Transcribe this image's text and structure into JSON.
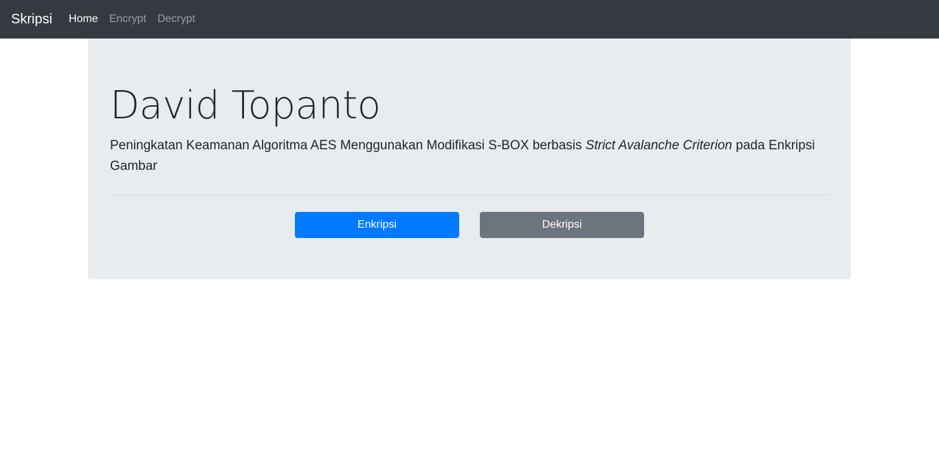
{
  "navbar": {
    "brand": "Skripsi",
    "links": [
      {
        "label": "Home",
        "active": true
      },
      {
        "label": "Encrypt",
        "active": false
      },
      {
        "label": "Decrypt",
        "active": false
      }
    ]
  },
  "jumbotron": {
    "title": "David Topanto",
    "lead_before": "Peningkatan Keamanan Algoritma AES Menggunakan Modifikasi S-BOX berbasis ",
    "lead_emphasis": "Strict Avalanche Criterion",
    "lead_after": " pada Enkripsi Gambar",
    "buttons": {
      "encrypt_label": "Enkripsi",
      "decrypt_label": "Dekripsi"
    }
  },
  "colors": {
    "navbar_bg": "#343a40",
    "jumbotron_bg": "#e9ecef",
    "primary": "#007bff",
    "secondary": "#6c757d"
  }
}
